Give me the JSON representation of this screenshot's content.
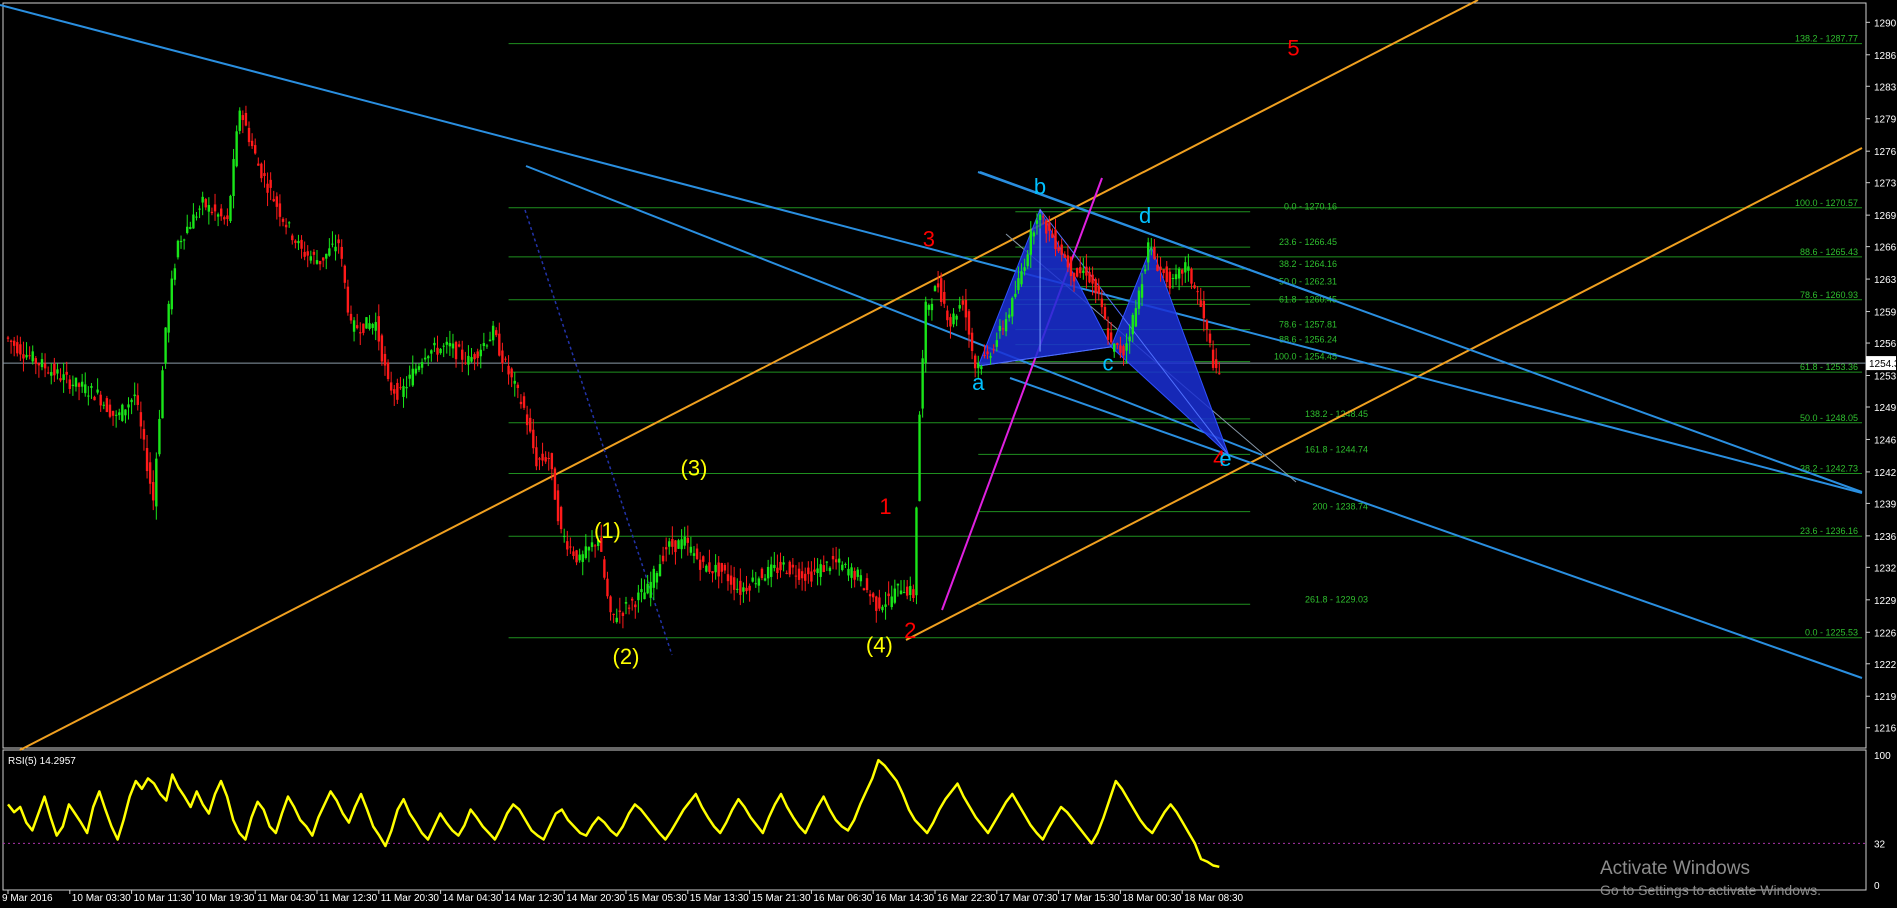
{
  "chart_data": {
    "type": "line",
    "title": "",
    "xlabel": "",
    "ylabel": "",
    "ylim": [
      1214.5,
      1291.5
    ],
    "y_ticks": [
      1290.0,
      1286.6,
      1283.3,
      1279.9,
      1276.5,
      1273.2,
      1269.8,
      1266.5,
      1263.1,
      1259.7,
      1256.4,
      1253.0,
      1249.7,
      1246.3,
      1242.9,
      1239.6,
      1236.2,
      1232.9,
      1229.5,
      1226.1,
      1222.8,
      1219.4,
      1216.1
    ],
    "y_tick_labels": [
      "1290.0",
      "1286.6",
      "1283.3",
      "1279.9",
      "1276.5",
      "1273.2",
      "1269.8",
      "1266.5",
      "1263.1",
      "1259.7",
      "1256.4",
      "1253.0",
      "1249.7",
      "1246.3",
      "1242.9",
      "1239.6",
      "1236.2",
      "1232.9",
      "1229.5",
      "1226.1",
      "1222.8",
      "1219.4",
      "1216.1"
    ],
    "current_price_label": "1254.3",
    "current_price": 1254.3,
    "x_tick_labels": [
      "9 Mar 2016",
      "10 Mar 03:30",
      "10 Mar 11:30",
      "10 Mar 19:30",
      "11 Mar 04:30",
      "11 Mar 12:30",
      "11 Mar 20:30",
      "14 Mar 04:30",
      "14 Mar 12:30",
      "14 Mar 20:30",
      "15 Mar 05:30",
      "15 Mar 13:30",
      "15 Mar 21:30",
      "16 Mar 06:30",
      "16 Mar 14:30",
      "16 Mar 22:30",
      "17 Mar 07:30",
      "17 Mar 15:30",
      "18 Mar 00:30",
      "18 Mar 08:30"
    ],
    "x_range": [
      0,
      300
    ],
    "x_ticks": [
      0,
      10,
      20,
      30,
      40,
      50,
      60,
      70,
      80,
      90,
      100,
      110,
      120,
      130,
      140,
      150,
      160,
      170,
      180,
      190
    ],
    "anchors": [
      {
        "x": 0,
        "v": 1257.0
      },
      {
        "x": 5,
        "v": 1254.5
      },
      {
        "x": 10,
        "v": 1252.5
      },
      {
        "x": 15,
        "v": 1251.0
      },
      {
        "x": 18,
        "v": 1248.5
      },
      {
        "x": 21,
        "v": 1251.0
      },
      {
        "x": 24,
        "v": 1240.0
      },
      {
        "x": 26,
        "v": 1258.0
      },
      {
        "x": 28,
        "v": 1267.0
      },
      {
        "x": 32,
        "v": 1271.0
      },
      {
        "x": 36,
        "v": 1269.0
      },
      {
        "x": 38,
        "v": 1281.0
      },
      {
        "x": 41,
        "v": 1275.0
      },
      {
        "x": 45,
        "v": 1269.5
      },
      {
        "x": 48,
        "v": 1266.0
      },
      {
        "x": 51,
        "v": 1265.0
      },
      {
        "x": 54,
        "v": 1267.0
      },
      {
        "x": 56,
        "v": 1258.0
      },
      {
        "x": 60,
        "v": 1258.5
      },
      {
        "x": 62,
        "v": 1252.0
      },
      {
        "x": 64,
        "v": 1251.0
      },
      {
        "x": 68,
        "v": 1255.5
      },
      {
        "x": 72,
        "v": 1256.0
      },
      {
        "x": 75,
        "v": 1254.5
      },
      {
        "x": 79,
        "v": 1257.5
      },
      {
        "x": 81,
        "v": 1254.0
      },
      {
        "x": 84,
        "v": 1249.5
      },
      {
        "x": 86,
        "v": 1244.0
      },
      {
        "x": 88,
        "v": 1244.5
      },
      {
        "x": 90,
        "v": 1236.5
      },
      {
        "x": 93,
        "v": 1233.5
      },
      {
        "x": 96,
        "v": 1236.0
      },
      {
        "x": 98,
        "v": 1227.5
      },
      {
        "x": 101,
        "v": 1229.0
      },
      {
        "x": 104,
        "v": 1230.5
      },
      {
        "x": 107,
        "v": 1235.0
      },
      {
        "x": 110,
        "v": 1235.5
      },
      {
        "x": 113,
        "v": 1233.0
      },
      {
        "x": 116,
        "v": 1232.5
      },
      {
        "x": 119,
        "v": 1230.5
      },
      {
        "x": 122,
        "v": 1232.0
      },
      {
        "x": 126,
        "v": 1233.0
      },
      {
        "x": 130,
        "v": 1232.0
      },
      {
        "x": 134,
        "v": 1233.5
      },
      {
        "x": 138,
        "v": 1232.0
      },
      {
        "x": 141,
        "v": 1229.0
      },
      {
        "x": 143,
        "v": 1229.5
      },
      {
        "x": 145,
        "v": 1231.0
      },
      {
        "x": 147,
        "v": 1230.0
      },
      {
        "x": 148,
        "v": 1249.0
      },
      {
        "x": 149,
        "v": 1260.0
      },
      {
        "x": 151,
        "v": 1262.5
      },
      {
        "x": 153,
        "v": 1258.5
      },
      {
        "x": 155,
        "v": 1261.0
      },
      {
        "x": 157,
        "v": 1254.0
      },
      {
        "x": 159,
        "v": 1255.0
      },
      {
        "x": 161,
        "v": 1257.5
      },
      {
        "x": 163,
        "v": 1260.5
      },
      {
        "x": 165,
        "v": 1265.0
      },
      {
        "x": 167,
        "v": 1270.0
      },
      {
        "x": 169,
        "v": 1268.0
      },
      {
        "x": 171,
        "v": 1266.0
      },
      {
        "x": 173,
        "v": 1263.5
      },
      {
        "x": 175,
        "v": 1264.0
      },
      {
        "x": 177,
        "v": 1261.0
      },
      {
        "x": 179,
        "v": 1256.0
      },
      {
        "x": 181,
        "v": 1255.5
      },
      {
        "x": 183,
        "v": 1260.0
      },
      {
        "x": 185,
        "v": 1266.5
      },
      {
        "x": 187,
        "v": 1264.0
      },
      {
        "x": 189,
        "v": 1262.5
      },
      {
        "x": 191,
        "v": 1264.5
      },
      {
        "x": 193,
        "v": 1261.5
      },
      {
        "x": 195,
        "v": 1256.0
      },
      {
        "x": 196,
        "v": 1253.0
      }
    ],
    "fib_levels_right": [
      {
        "label": "138.2 - 1287.77",
        "v": 1287.77
      },
      {
        "label": "100.0 - 1270.57",
        "v": 1270.57
      },
      {
        "label": "88.6 - 1265.43",
        "v": 1265.43
      },
      {
        "label": "78.6 - 1260.93",
        "v": 1260.93
      },
      {
        "label": "61.8 - 1253.36",
        "v": 1253.36
      },
      {
        "label": "50.0 - 1248.05",
        "v": 1248.05
      },
      {
        "label": "38.2 - 1242.73",
        "v": 1242.73
      },
      {
        "label": "23.6 - 1236.16",
        "v": 1236.16
      },
      {
        "label": "0.0 - 1225.53",
        "v": 1225.53
      }
    ],
    "fib_levels_mid": [
      {
        "label": "0.0 - 1270.16",
        "v": 1270.16
      },
      {
        "label": "23.6 - 1266.45",
        "v": 1266.45
      },
      {
        "label": "38.2 - 1264.16",
        "v": 1264.16
      },
      {
        "label": "50.0 - 1262.31",
        "v": 1262.31
      },
      {
        "label": "61.8 - 1260.45",
        "v": 1260.45
      },
      {
        "label": "78.6 - 1257.81",
        "v": 1257.81
      },
      {
        "label": "88.6 - 1256.24",
        "v": 1256.24
      },
      {
        "label": "100.0 - 1254.45",
        "v": 1254.45
      }
    ],
    "fib_levels_ext": [
      {
        "label": "138.2 - 1248.45",
        "v": 1248.45
      },
      {
        "label": "161.8 - 1244.74",
        "v": 1244.74
      },
      {
        "label": "200 - 1238.74",
        "v": 1238.74
      },
      {
        "label": "261.8 - 1229.03",
        "v": 1229.03
      }
    ],
    "wave_labels": [
      {
        "text": "(1)",
        "x": 97,
        "v": 1236.0,
        "color": "#ffff00"
      },
      {
        "text": "(2)",
        "x": 100,
        "v": 1222.8,
        "color": "#ffff00"
      },
      {
        "text": "(3)",
        "x": 111,
        "v": 1242.5,
        "color": "#ffff00"
      },
      {
        "text": "(4)",
        "x": 141,
        "v": 1224.0,
        "color": "#ffff00"
      },
      {
        "text": "1",
        "x": 142,
        "v": 1238.5,
        "color": "#ff0000"
      },
      {
        "text": "2",
        "x": 146,
        "v": 1225.5,
        "color": "#ff0000"
      },
      {
        "text": "3",
        "x": 149,
        "v": 1266.5,
        "color": "#ff0000"
      },
      {
        "text": "4",
        "x": 196,
        "v": 1243.5,
        "color": "#ff0000"
      },
      {
        "text": "5",
        "x": 208,
        "v": 1286.5,
        "color": "#ff0000"
      },
      {
        "text": "a",
        "x": 157,
        "v": 1251.5,
        "color": "#00c0ff"
      },
      {
        "text": "b",
        "x": 167,
        "v": 1272.0,
        "color": "#00c0ff"
      },
      {
        "text": "c",
        "x": 178,
        "v": 1253.5,
        "color": "#00c0ff"
      },
      {
        "text": "d",
        "x": 184,
        "v": 1269.0,
        "color": "#00c0ff"
      },
      {
        "text": "e",
        "x": 197,
        "v": 1243.5,
        "color": "#00c0ff"
      }
    ],
    "rsi": {
      "label": "RSI(5) 14.2957",
      "ylim": [
        0,
        100
      ],
      "ticks": [
        100,
        32,
        0
      ],
      "tick_labels": [
        "100",
        "32",
        "0"
      ],
      "level": 32,
      "values": [
        62,
        56,
        60,
        48,
        42,
        55,
        68,
        52,
        38,
        45,
        62,
        55,
        48,
        40,
        60,
        72,
        58,
        45,
        35,
        50,
        68,
        80,
        74,
        82,
        78,
        70,
        65,
        85,
        75,
        68,
        60,
        72,
        62,
        55,
        70,
        80,
        68,
        50,
        40,
        35,
        52,
        64,
        58,
        45,
        40,
        55,
        68,
        60,
        50,
        45,
        38,
        52,
        62,
        72,
        65,
        55,
        48,
        60,
        70,
        58,
        45,
        38,
        30,
        42,
        58,
        66,
        55,
        48,
        40,
        35,
        45,
        55,
        48,
        42,
        38,
        46,
        58,
        52,
        45,
        40,
        35,
        44,
        55,
        62,
        58,
        50,
        42,
        38,
        35,
        45,
        55,
        58,
        50,
        45,
        40,
        38,
        46,
        52,
        48,
        42,
        38,
        45,
        55,
        62,
        58,
        52,
        46,
        40,
        35,
        42,
        50,
        58,
        64,
        70,
        60,
        52,
        45,
        40,
        48,
        58,
        66,
        60,
        52,
        46,
        40,
        52,
        62,
        70,
        60,
        52,
        45,
        40,
        50,
        60,
        68,
        58,
        50,
        45,
        42,
        50,
        62,
        72,
        82,
        96,
        92,
        86,
        80,
        70,
        58,
        50,
        45,
        40,
        48,
        58,
        66,
        72,
        78,
        68,
        60,
        52,
        46,
        40,
        48,
        56,
        64,
        70,
        62,
        54,
        46,
        40,
        35,
        44,
        52,
        60,
        56,
        50,
        44,
        38,
        32,
        40,
        52,
        66,
        80,
        74,
        66,
        58,
        50,
        44,
        40,
        48,
        56,
        62,
        56,
        48,
        40,
        32,
        20,
        18,
        15,
        14
      ]
    }
  },
  "watermark": {
    "line1": "Activate Windows",
    "line2": "Go to Settings to activate Windows."
  }
}
